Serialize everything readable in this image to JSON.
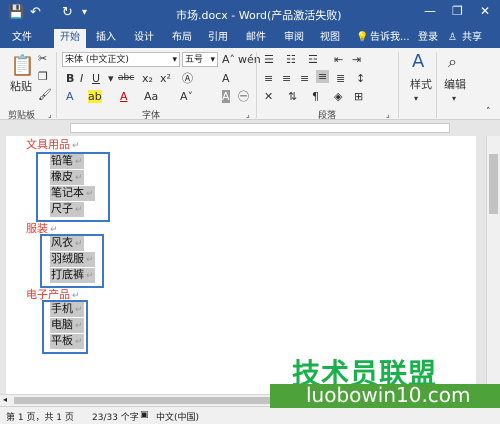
{
  "window": {
    "title": "市场.docx - Word(产品激活失败)",
    "minimize": "—",
    "restore": "❐",
    "close": "✕"
  },
  "quick_access": {
    "save_icon": "💾",
    "undo_icon": "↶",
    "redo_icon": "↻",
    "more_icon": "▾"
  },
  "tabs": [
    "文件",
    "开始",
    "插入",
    "设计",
    "布局",
    "引用",
    "邮件",
    "审阅",
    "视图"
  ],
  "tell_me": "告诉我...",
  "login": "登录",
  "share": "共享",
  "ribbon": {
    "clipboard_label": "剪贴板",
    "paste_label": "粘贴",
    "font_label": "字体",
    "paragraph_label": "段落",
    "font_name": "宋体 (中文正文)",
    "font_size": "五号",
    "styles_label": "样式",
    "edit_label": "编辑"
  },
  "document": {
    "groups": [
      {
        "heading": "文具用品",
        "items": [
          "铅笔",
          "橡皮",
          "笔记本",
          "尺子"
        ]
      },
      {
        "heading": "服装",
        "items": [
          "风衣",
          "羽绒服",
          "打底裤"
        ]
      },
      {
        "heading": "电子产品",
        "items": [
          "手机",
          "电脑",
          "平板"
        ]
      }
    ]
  },
  "status": {
    "page": "第 1 页，共 1 页",
    "words": "23/33 个字",
    "lang": "中文(中国)"
  },
  "watermark": {
    "line1": "技术员联盟",
    "line2": "luobowin10.com"
  }
}
